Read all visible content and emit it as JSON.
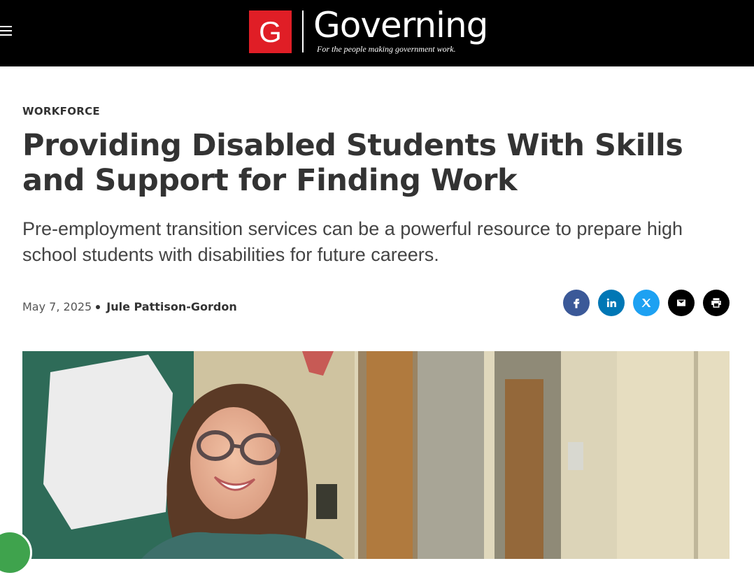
{
  "header": {
    "logo_letter": "G",
    "brand_name": "Governing",
    "tagline": "For the people making government work.",
    "logo_color": "#e01e26"
  },
  "article": {
    "section": "WORKFORCE",
    "headline": "Providing Disabled Students With Skills and Support for Finding Work",
    "deck": "Pre-employment transition services can be a powerful resource to prepare high school students with disabilities for future careers.",
    "date": "May 7, 2025",
    "author": "Jule Pattison-Gordon"
  },
  "share": [
    {
      "name": "facebook-icon",
      "color": "#3b5998"
    },
    {
      "name": "linkedin-icon",
      "color": "#0077b5"
    },
    {
      "name": "x-icon",
      "color": "#1da1f2"
    },
    {
      "name": "email-icon",
      "color": "#000000"
    },
    {
      "name": "print-icon",
      "color": "#000000"
    }
  ],
  "photo": {
    "subject": "student-smiling-in-hallway"
  }
}
